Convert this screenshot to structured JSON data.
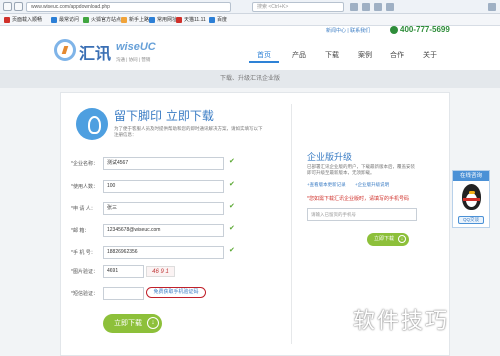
{
  "browser": {
    "url": "www.wiseuc.com/appdownload.php",
    "search_placeholder": "搜索 <Ctrl+K>"
  },
  "bookmarks": [
    {
      "label": "页面载入顺畅"
    },
    {
      "label": "最常访问"
    },
    {
      "label": "火狐官方站点"
    },
    {
      "label": "新手上路"
    },
    {
      "label": "常用网址"
    },
    {
      "label": "天猫11.11"
    },
    {
      "label": "百度"
    }
  ],
  "header": {
    "logo_text": "汇讯",
    "logo_brand": "wiseUC",
    "logo_slogan": "沟通 | 协同 | 营销",
    "top_links": "新闻中心 | 联系我们",
    "phone": "400-777-5699",
    "nav": [
      "首页",
      "产品",
      "下载",
      "案例",
      "合作",
      "关于"
    ]
  },
  "band_text": "下载、升级汇讯企业版",
  "form": {
    "title": "留下脚印 立即下载",
    "description": "为了便于客服人员及时提供帮助和您的即时通讯解决方案，请如实填写以下注册信息：",
    "fields": [
      {
        "label": "*企业名称：",
        "value": "测试4567"
      },
      {
        "label": "*使用人数：",
        "value": "100"
      },
      {
        "label": "*申 请 人：",
        "value": "张三"
      },
      {
        "label": "*邮    箱：",
        "value": "12345678@wiseuc.com"
      },
      {
        "label": "*手 机 号：",
        "value": "18826962356"
      }
    ],
    "captcha_label": "*图片验证：",
    "captcha_value": "4691",
    "captcha_image_text": "46 9 1",
    "sms_label": "*短信验证：",
    "sms_button": "免费获取手机验证码",
    "submit": "立即下载"
  },
  "upgrade": {
    "title": "企业版升级",
    "description": "已部署汇讯企业版的用户，下载最新版本后，覆盖安装即可升级至最新版本，无须卸载。",
    "links": [
      "+查看版本更新记录",
      "+企业版升级说明"
    ],
    "warning": "*您如需下载汇讯企业版时，请填写的手机号码",
    "input_placeholder": "请输入已留资的手机号",
    "button": "立即下载"
  },
  "qq": {
    "title": "在线咨询",
    "button": "QQ交谈"
  },
  "watermark": "软件技巧"
}
